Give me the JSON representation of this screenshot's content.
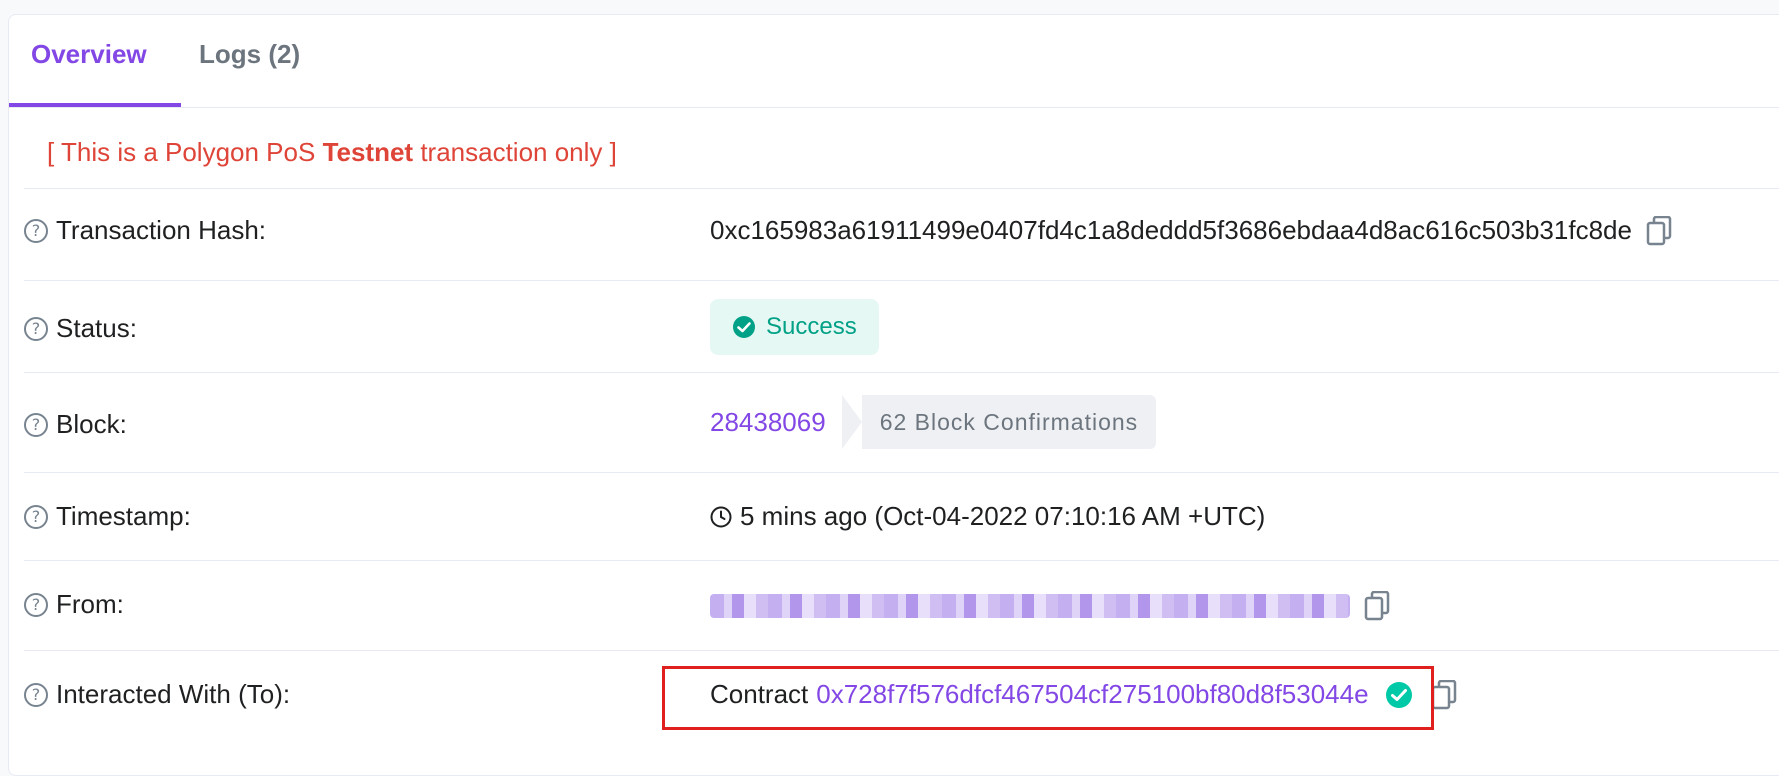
{
  "tabs": [
    {
      "label": "Overview",
      "active": true
    },
    {
      "label": "Logs (2)",
      "active": false
    }
  ],
  "notice": {
    "prefix": "[ This is a Polygon PoS ",
    "bold": "Testnet",
    "suffix": " transaction only ]"
  },
  "rows": {
    "hash": {
      "label": "Transaction Hash:",
      "value": "0xc165983a61911499e0407fd4c1a8deddd5f3686ebdaa4d8ac616c503b31fc8de"
    },
    "status": {
      "label": "Status:",
      "value": "Success"
    },
    "block": {
      "label": "Block:",
      "number": "28438069",
      "confirmations": "62 Block Confirmations"
    },
    "timestamp": {
      "label": "Timestamp:",
      "value": "5 mins ago (Oct-04-2022 07:10:16 AM +UTC)"
    },
    "from": {
      "label": "From:"
    },
    "to": {
      "label": "Interacted With (To):",
      "prefix": "Contract",
      "address": "0x728f7f576dfcf467504cf275100bf80d8f53044e"
    }
  },
  "colors": {
    "accent": "#8247e5",
    "success": "#00a186",
    "danger": "#de4437",
    "highlight_box": "#e0201c"
  },
  "icons": {
    "help": "question-circle-icon",
    "copy": "copy-icon",
    "status": "check-circle-icon",
    "clock": "clock-icon",
    "verified": "verified-check-icon"
  }
}
